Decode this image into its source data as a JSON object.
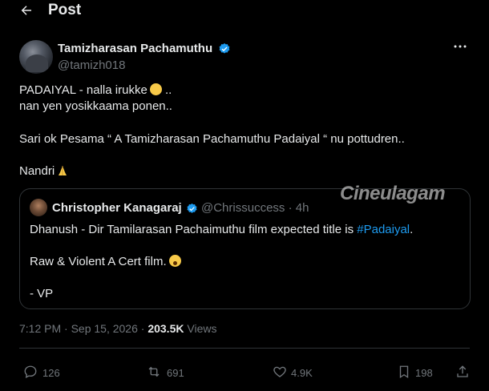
{
  "header": {
    "title": "Post"
  },
  "author": {
    "name": "Tamizharasan Pachamuthu",
    "handle": "@tamizh018"
  },
  "tweet": {
    "line1": "PADAIYAL - nalla irukke",
    "line1_suffix": " ..",
    "line2": "nan yen yosikkaama ponen..",
    "line3": "Sari ok Pesama “ A Tamizharasan Pachamuthu Padaiyal “ nu pottudren..",
    "line4": "Nandri"
  },
  "quote": {
    "name": "Christopher Kanagaraj",
    "handle": "@Chrissuccess · 4h",
    "line1_prefix": "Dhanush -  Dir Tamilarasan Pachaimuthu film expected title is ",
    "hashtag": "#Padaiyal",
    "line1_suffix": ".",
    "line2": "Raw & Violent A Cert film.",
    "line3": "- VP"
  },
  "watermark": "Cineulagam",
  "meta": {
    "time_date": "7:12 PM · Sep 15, 2026 · ",
    "views_count": "203.5K",
    "views_label": " Views"
  },
  "actions": {
    "replies": "126",
    "reposts": "691",
    "likes": "4.9K",
    "bookmarks": "198"
  },
  "icons": [
    "back-arrow-icon",
    "verified-badge-icon",
    "more-icon",
    "reply-icon",
    "repost-icon",
    "like-icon",
    "bookmark-icon",
    "share-icon"
  ],
  "colors": {
    "background": "#000000",
    "text": "#e7e9ea",
    "muted": "#71767b",
    "accent": "#1d9bf0",
    "border": "#2f3336"
  }
}
